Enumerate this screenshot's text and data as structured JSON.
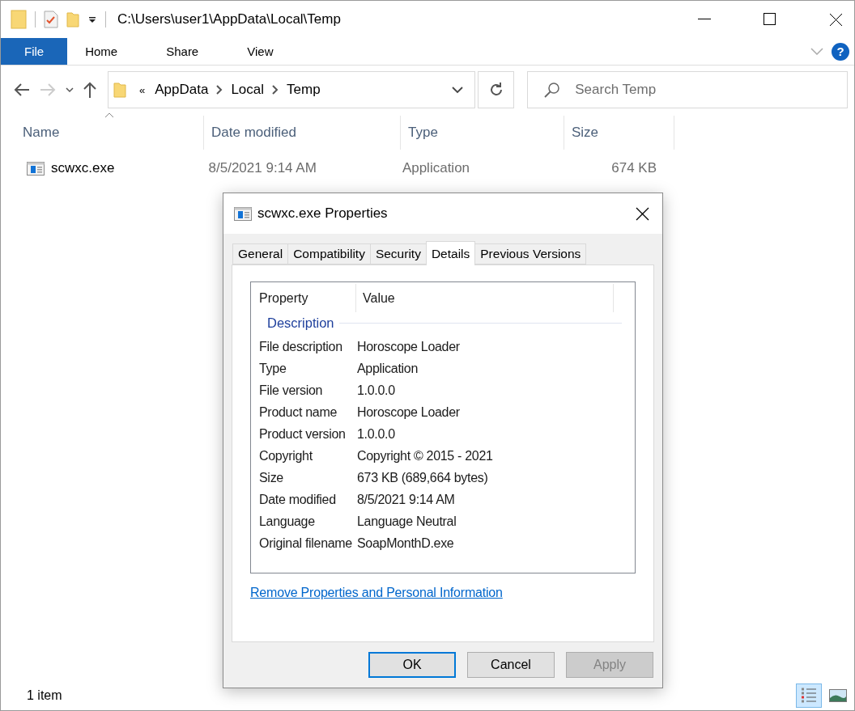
{
  "window": {
    "title": "C:\\Users\\user1\\AppData\\Local\\Temp"
  },
  "ribbon": {
    "tabs": [
      {
        "label": "File",
        "selected": true
      },
      {
        "label": "Home",
        "selected": false
      },
      {
        "label": "Share",
        "selected": false
      },
      {
        "label": "View",
        "selected": false
      }
    ],
    "help": "?"
  },
  "address": {
    "overflow": "«",
    "crumbs": [
      "AppData",
      "Local",
      "Temp"
    ]
  },
  "search": {
    "placeholder": "Search Temp"
  },
  "columns": [
    {
      "label": "Name",
      "sorted": true
    },
    {
      "label": "Date modified",
      "sorted": false
    },
    {
      "label": "Type",
      "sorted": false
    },
    {
      "label": "Size",
      "sorted": false
    }
  ],
  "files": [
    {
      "name": "scwxc.exe",
      "date": "8/5/2021 9:14 AM",
      "type": "Application",
      "size": "674 KB",
      "selected": false
    }
  ],
  "status_bar": {
    "count": "1 item",
    "views": [
      {
        "kind": "details",
        "selected": true
      },
      {
        "kind": "thumbnails",
        "selected": false
      }
    ]
  },
  "dialog": {
    "title": "scwxc.exe Properties",
    "tabs": [
      {
        "label": "General",
        "selected": false
      },
      {
        "label": "Compatibility",
        "selected": false
      },
      {
        "label": "Security",
        "selected": false
      },
      {
        "label": "Details",
        "selected": true
      },
      {
        "label": "Previous Versions",
        "selected": false
      }
    ],
    "columns": [
      "Property",
      "Value"
    ],
    "group": "Description",
    "properties": [
      {
        "name": "File description",
        "value": "Horoscope Loader"
      },
      {
        "name": "Type",
        "value": "Application"
      },
      {
        "name": "File version",
        "value": "1.0.0.0"
      },
      {
        "name": "Product name",
        "value": "Horoscope Loader"
      },
      {
        "name": "Product version",
        "value": "1.0.0.0"
      },
      {
        "name": "Copyright",
        "value": "Copyright © 2015 - 2021"
      },
      {
        "name": "Size",
        "value": "673 KB (689,664 bytes)"
      },
      {
        "name": "Date modified",
        "value": "8/5/2021 9:14 AM"
      },
      {
        "name": "Language",
        "value": "Language Neutral"
      },
      {
        "name": "Original filename",
        "value": "SoapMonthD.exe"
      }
    ],
    "link": "Remove Properties and Personal Information",
    "buttons": [
      {
        "label": "OK",
        "default": true,
        "disabled": false
      },
      {
        "label": "Cancel",
        "default": false,
        "disabled": false
      },
      {
        "label": "Apply",
        "default": false,
        "disabled": true
      }
    ]
  }
}
